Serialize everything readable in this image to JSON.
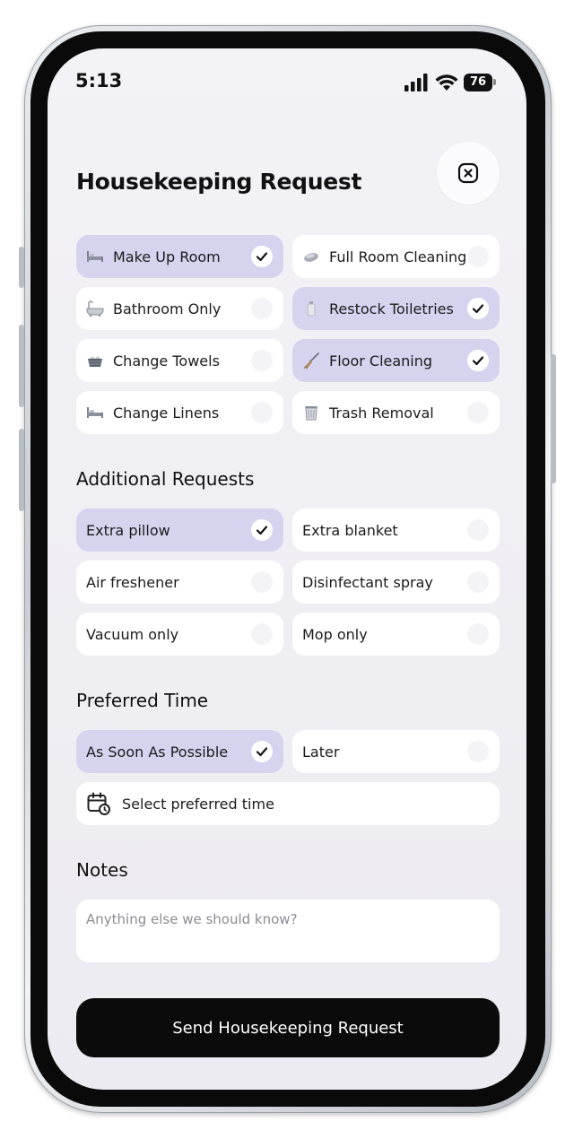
{
  "status_bar": {
    "time": "5:13",
    "battery": "76"
  },
  "header": {
    "title": "Housekeeping Request"
  },
  "services": [
    {
      "label": "Make Up Room",
      "icon": "bed-icon",
      "selected": true
    },
    {
      "label": "Full Room Cleaning",
      "icon": "soap-icon",
      "selected": false
    },
    {
      "label": "Bathroom Only",
      "icon": "bathtub-icon",
      "selected": false
    },
    {
      "label": "Restock Toiletries",
      "icon": "lotion-bottle-icon",
      "selected": true
    },
    {
      "label": "Change Towels",
      "icon": "towel-basket-icon",
      "selected": false
    },
    {
      "label": "Floor Cleaning",
      "icon": "broom-icon",
      "selected": true
    },
    {
      "label": "Change Linens",
      "icon": "bed-icon",
      "selected": false
    },
    {
      "label": "Trash Removal",
      "icon": "wastebasket-icon",
      "selected": false
    }
  ],
  "additional": {
    "title": "Additional Requests",
    "items": [
      {
        "label": "Extra pillow",
        "selected": true
      },
      {
        "label": "Extra blanket",
        "selected": false
      },
      {
        "label": "Air freshener",
        "selected": false
      },
      {
        "label": "Disinfectant spray",
        "selected": false
      },
      {
        "label": "Vacuum only",
        "selected": false
      },
      {
        "label": "Mop only",
        "selected": false
      }
    ]
  },
  "preferred_time": {
    "title": "Preferred Time",
    "options": [
      {
        "label": "As Soon As Possible",
        "selected": true
      },
      {
        "label": "Later",
        "selected": false
      }
    ],
    "select_label": "Select preferred time"
  },
  "notes": {
    "title": "Notes",
    "placeholder": "Anything else we should know?"
  },
  "submit": {
    "label": "Send Housekeeping Request"
  },
  "colors": {
    "selected_bg": "#d6d3ef",
    "button_bg": "#0b0b0b",
    "screen_bg": "#f3f2f6"
  }
}
